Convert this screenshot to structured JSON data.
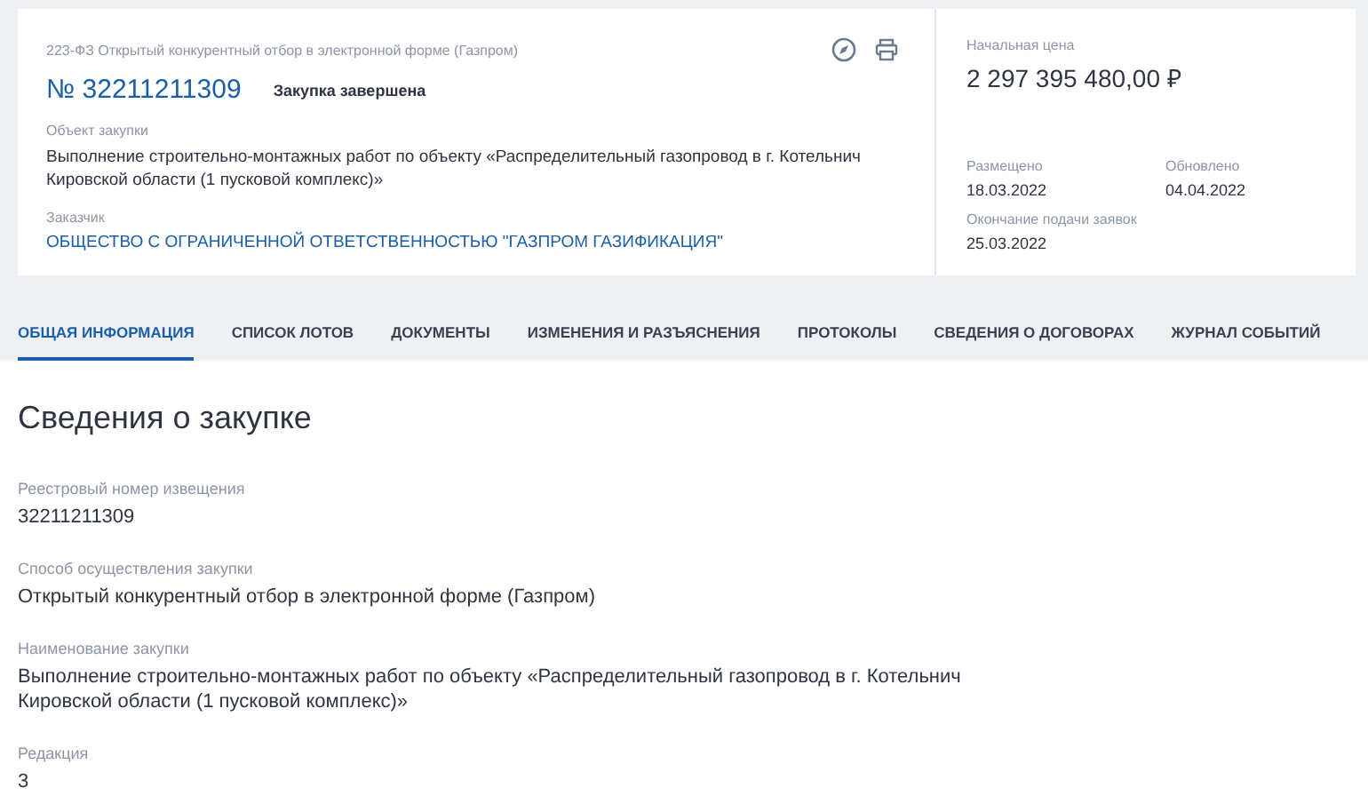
{
  "header": {
    "law_type": "223-ФЗ Открытый конкурентный отбор в электронной форме (Газпром)",
    "number": "№ 32211211309",
    "status": "Закупка завершена",
    "object_label": "Объект закупки",
    "object_text": "Выполнение строительно-монтажных работ по объекту «Распределительный газопровод в г. Котельнич Кировской области (1 пусковой комплекс)»",
    "customer_label": "Заказчик",
    "customer": "ОБЩЕСТВО С ОГРАНИЧЕННОЙ ОТВЕТСТВЕННОСТЬЮ \"ГАЗПРОМ ГАЗИФИКАЦИЯ\""
  },
  "price": {
    "label": "Начальная цена",
    "value": "2 297 395 480,00 ₽"
  },
  "dates": [
    {
      "label": "Размещено",
      "value": "18.03.2022"
    },
    {
      "label": "Обновлено",
      "value": "04.04.2022"
    },
    {
      "label": "Окончание подачи заявок",
      "value": "25.03.2022"
    }
  ],
  "tabs": [
    {
      "label": "ОБЩАЯ ИНФОРМАЦИЯ",
      "selected": true
    },
    {
      "label": "СПИСОК ЛОТОВ",
      "selected": false
    },
    {
      "label": "ДОКУМЕНТЫ",
      "selected": false
    },
    {
      "label": "ИЗМЕНЕНИЯ И РАЗЪЯСНЕНИЯ",
      "selected": false
    },
    {
      "label": "ПРОТОКОЛЫ",
      "selected": false
    },
    {
      "label": "СВЕДЕНИЯ О ДОГОВОРАХ",
      "selected": false
    },
    {
      "label": "ЖУРНАЛ СОБЫТИЙ",
      "selected": false
    }
  ],
  "section": {
    "title": "Сведения о закупке",
    "fields": [
      {
        "label": "Реестровый номер извещения",
        "value": "32211211309"
      },
      {
        "label": "Способ осуществления закупки",
        "value": "Открытый конкурентный отбор в электронной форме (Газпром)"
      },
      {
        "label": "Наименование закупки",
        "value": "Выполнение строительно-монтажных работ по объекту «Распределительный газопровод в г. Котельнич Кировской области (1 пусковой комплекс)»"
      },
      {
        "label": "Редакция",
        "value": "3"
      }
    ]
  }
}
